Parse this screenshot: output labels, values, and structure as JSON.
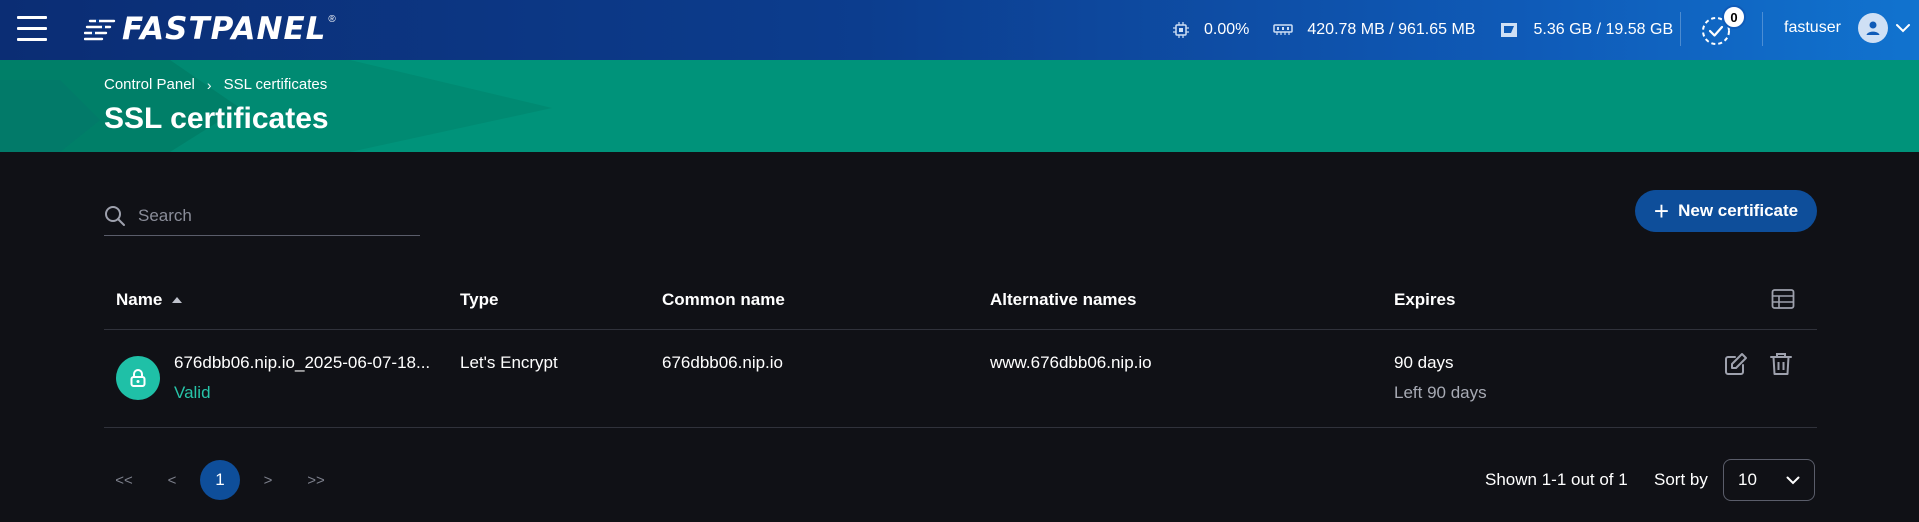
{
  "app": {
    "logo_text": "FASTPANEL",
    "logo_mark": "®"
  },
  "topbar": {
    "cpu": "0.00%",
    "memory": "420.78 MB / 961.65 MB",
    "disk": "5.36 GB / 19.58 GB",
    "tasks_count": "0",
    "username": "fastuser"
  },
  "header": {
    "breadcrumb": [
      "Control Panel",
      "SSL certificates"
    ],
    "title": "SSL certificates"
  },
  "search": {
    "placeholder": "Search",
    "value": ""
  },
  "new_button": {
    "label": "New certificate"
  },
  "table": {
    "columns": [
      "Name",
      "Type",
      "Common name",
      "Alternative names",
      "Expires"
    ],
    "rows": [
      {
        "name": "676dbb06.nip.io_2025-06-07-18...",
        "status": "Valid",
        "type": "Let's Encrypt",
        "common_name": "676dbb06.nip.io",
        "alt_names": "www.676dbb06.nip.io",
        "expires": "90 days",
        "expires_left": "Left 90 days"
      }
    ]
  },
  "pagination": {
    "first": "<<",
    "prev": "<",
    "current": "1",
    "next": ">",
    "last": ">>",
    "shown": "Shown 1-1 out of 1",
    "sort_label": "Sort by",
    "page_size": "10"
  },
  "colors": {
    "accent": "#0e4e9a",
    "header": "#00937a",
    "valid": "#27c4a8"
  }
}
